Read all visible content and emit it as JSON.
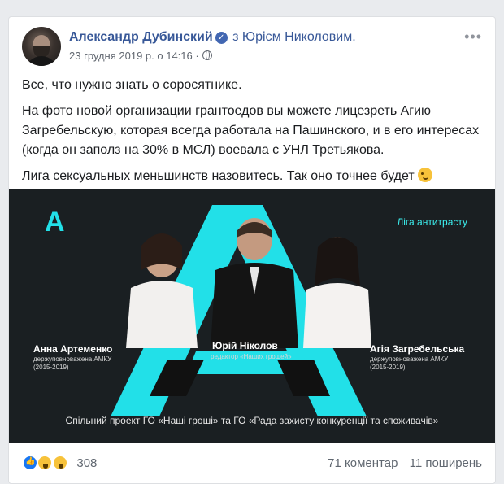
{
  "post": {
    "author": "Александр Дубинский",
    "with_text": "з Юрієм Николовим.",
    "timestamp": "23 грудня 2019 р. о 14:16 ·",
    "paragraphs": [
      "Все, что нужно знать о соросятнике.",
      "На фото новой организации грантоедов вы можете лицезреть Агию Загребельскую, которая всегда работала на Пашинского, и в его интересах (когда он заполз на 30% в МСЛ) воевала с УНЛ Третьякова.",
      "Лига сексуальных меньшинств назовитесь. Так оно точнее будет"
    ]
  },
  "image": {
    "logo": "A",
    "brand": "Ліга антитрасту",
    "people": [
      {
        "name": "Анна Артеменко",
        "role": "держуповноважена АМКУ",
        "years": "(2015-2019)"
      },
      {
        "name": "Юрій Ніколов",
        "role": "редактор «Наших грошей»",
        "years": ""
      },
      {
        "name": "Агія Загребельська",
        "role": "держуповноважена АМКУ",
        "years": "(2015-2019)"
      }
    ],
    "footer": "Спільний проект ГО «Наші гроші» та ГО «Рада захисту конкуренції та споживачів»"
  },
  "stats": {
    "reactions": [
      "like-icon",
      "haha-icon",
      "wow-icon"
    ],
    "count": "308",
    "comments": "71 коментар",
    "shares": "11 поширень"
  },
  "colors": {
    "accent": "#385898",
    "cyan": "#22e0e8"
  }
}
